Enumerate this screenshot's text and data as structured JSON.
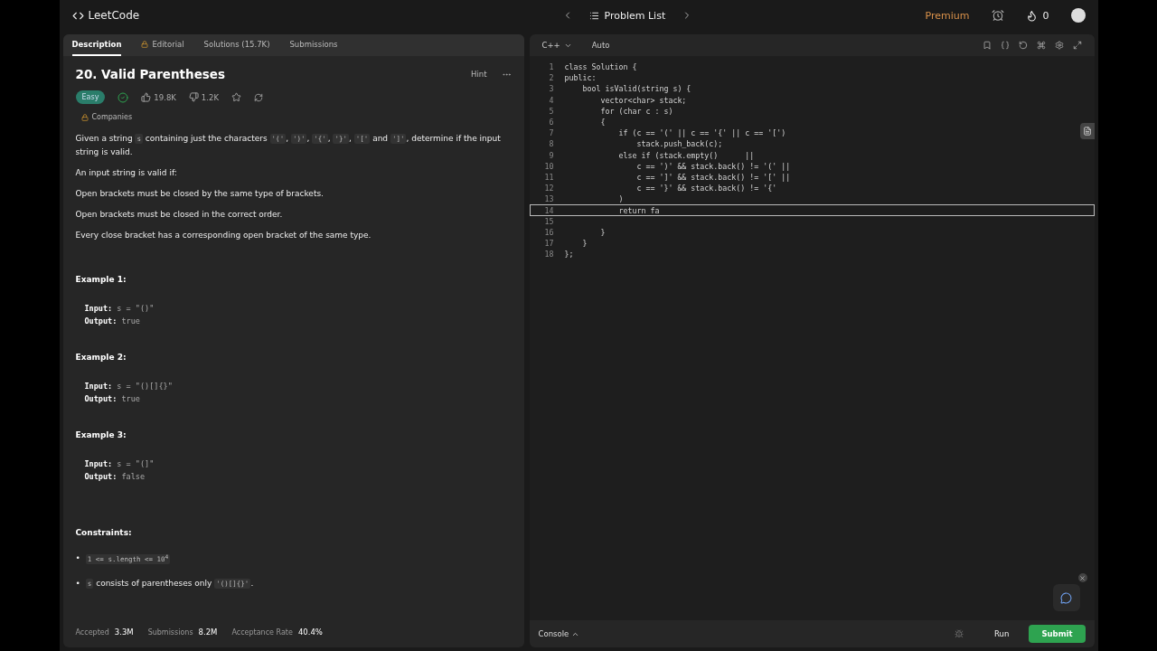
{
  "nav": {
    "logo": "LeetCode",
    "problem_list": "Problem List",
    "premium": "Premium",
    "streak": "0"
  },
  "left_tabs": [
    {
      "label": "Description",
      "selected": true,
      "locked": false
    },
    {
      "label": "Editorial",
      "selected": false,
      "locked": true
    },
    {
      "label": "Solutions (15.7K)",
      "selected": false,
      "locked": false
    },
    {
      "label": "Submissions",
      "selected": false,
      "locked": false
    }
  ],
  "problem": {
    "title": "20. Valid Parentheses",
    "hint": "Hint",
    "difficulty": "Easy",
    "solved": true,
    "likes": "19.8K",
    "dislikes": "1.2K",
    "companies": "Companies"
  },
  "description": [
    [
      {
        "kind": "text",
        "text": "Given a string "
      },
      {
        "kind": "code",
        "text": "s"
      },
      {
        "kind": "text",
        "text": " containing just the characters "
      },
      {
        "kind": "code",
        "text": "'('"
      },
      {
        "kind": "text",
        "text": ", "
      },
      {
        "kind": "code",
        "text": "')'"
      },
      {
        "kind": "text",
        "text": ", "
      },
      {
        "kind": "code",
        "text": "'{'"
      },
      {
        "kind": "text",
        "text": ", "
      },
      {
        "kind": "code",
        "text": "'}'"
      },
      {
        "kind": "text",
        "text": ", "
      },
      {
        "kind": "code",
        "text": "'['"
      },
      {
        "kind": "text",
        "text": " and "
      },
      {
        "kind": "code",
        "text": "']'"
      },
      {
        "kind": "text",
        "text": ", determine if the input string is valid."
      }
    ],
    [
      {
        "kind": "text",
        "text": "An input string is valid if:"
      }
    ],
    [
      {
        "kind": "text",
        "text": "Open brackets must be closed by the same type of brackets."
      }
    ],
    [
      {
        "kind": "text",
        "text": "Open brackets must be closed in the correct order."
      }
    ],
    [
      {
        "kind": "text",
        "text": "Every close bracket has a corresponding open bracket of the same type."
      }
    ]
  ],
  "examples": [
    {
      "title": "Example 1:",
      "input_label": "Input:",
      "input": "s = \"()\"",
      "output_label": "Output:",
      "output": "true"
    },
    {
      "title": "Example 2:",
      "input_label": "Input:",
      "input": "s = \"()[]{}\"",
      "output_label": "Output:",
      "output": "true"
    },
    {
      "title": "Example 3:",
      "input_label": "Input:",
      "input": "s = \"(]\"",
      "output_label": "Output:",
      "output": "false"
    }
  ],
  "constraints_title": "Constraints:",
  "constraints": [
    {
      "bullet": "•",
      "parts": [
        {
          "kind": "code",
          "text": "1 <= s.length <= 10$^{4}$"
        }
      ]
    },
    {
      "bullet": "•",
      "parts": [
        {
          "kind": "code",
          "text": "s"
        },
        {
          "kind": "text",
          "text": " consists of parentheses only "
        },
        {
          "kind": "code",
          "text": "'()[]{}'"
        },
        {
          "kind": "text",
          "text": "."
        }
      ]
    }
  ],
  "stats": [
    {
      "label": "Accepted",
      "value": "3.3M"
    },
    {
      "label": "Submissions",
      "value": "8.2M"
    },
    {
      "label": "Acceptance Rate",
      "value": "40.4%"
    }
  ],
  "editor": {
    "language": "C++",
    "mode": "Auto",
    "lines": [
      {
        "number": "1",
        "code": "class Solution {",
        "current": false
      },
      {
        "number": "2",
        "code": "public:",
        "current": false
      },
      {
        "number": "3",
        "code": "    bool isValid(string s) {",
        "current": false
      },
      {
        "number": "4",
        "code": "        vector<char> stack;",
        "current": false
      },
      {
        "number": "5",
        "code": "        for (char c : s)",
        "current": false
      },
      {
        "number": "6",
        "code": "        {",
        "current": false
      },
      {
        "number": "7",
        "code": "            if (c == '(' || c == '{' || c == '[')",
        "current": false
      },
      {
        "number": "8",
        "code": "                stack.push_back(c);",
        "current": false
      },
      {
        "number": "9",
        "code": "            else if (stack.empty()      ||",
        "current": false
      },
      {
        "number": "10",
        "code": "                c == ')' && stack.back() != '(' ||",
        "current": false
      },
      {
        "number": "11",
        "code": "                c == ']' && stack.back() != '[' ||",
        "current": false
      },
      {
        "number": "12",
        "code": "                c == '}' && stack.back() != '{'",
        "current": false
      },
      {
        "number": "13",
        "code": "            )",
        "current": false
      },
      {
        "number": "14",
        "code": "            return fa",
        "current": true
      },
      {
        "number": "15",
        "current": false
      },
      {
        "number": "16",
        "code": "        }",
        "current": false
      },
      {
        "number": "17",
        "code": "    }",
        "current": false
      },
      {
        "number": "18",
        "code": "};",
        "current": false
      }
    ]
  },
  "console": {
    "label": "Console",
    "run": "Run",
    "submit": "Submit"
  }
}
